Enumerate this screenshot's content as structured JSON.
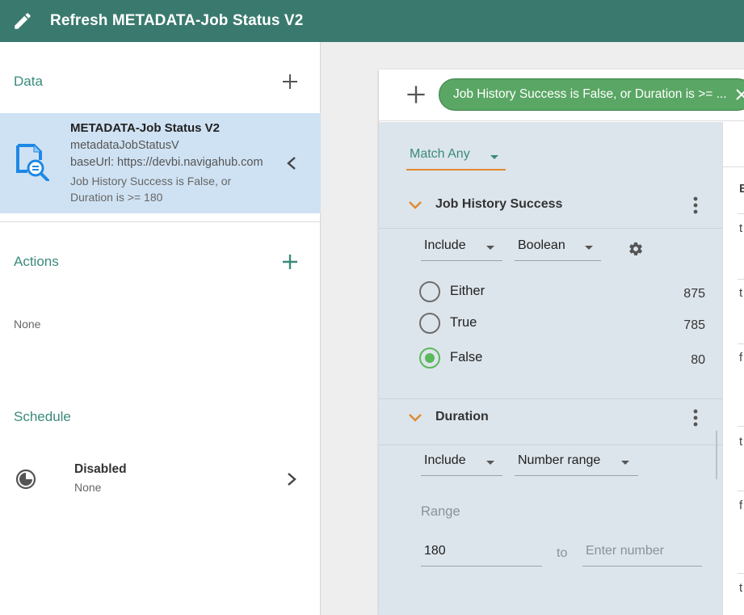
{
  "header": {
    "title": "Refresh METADATA-Job Status V2",
    "icon": "pencil-icon"
  },
  "left": {
    "data": {
      "title": "Data",
      "item": {
        "name": "METADATA-Job Status V2",
        "id": "metadataJobStatusV",
        "base_url": "baseUrl: https://devbi.navigahub.com",
        "description": "Job History Success is False, or Duration is >= 180"
      }
    },
    "actions": {
      "title": "Actions",
      "value": "None"
    },
    "schedule": {
      "title": "Schedule",
      "status": "Disabled",
      "value": "None"
    }
  },
  "filter": {
    "chip_label": "Job History Success is False, or Duration is >= ...",
    "match_mode": "Match Any",
    "groups": [
      {
        "title": "Job History Success",
        "mode": "Include",
        "type": "Boolean",
        "options": [
          {
            "label": "Either",
            "count": "875",
            "selected": false
          },
          {
            "label": "True",
            "count": "785",
            "selected": false
          },
          {
            "label": "False",
            "count": "80",
            "selected": true
          }
        ]
      },
      {
        "title": "Duration",
        "mode": "Include",
        "type": "Number range",
        "range_label": "Range",
        "from_value": "180",
        "to_label": "to",
        "to_placeholder": "Enter number"
      }
    ]
  },
  "results": {
    "header_partial": "E",
    "cells_partial": [
      "t",
      "t",
      "f",
      "t",
      "f",
      "t"
    ]
  },
  "colors": {
    "header_bg": "#3a7a6e",
    "accent_teal": "#3a8a7c",
    "selected_item_bg": "#cfe2f3",
    "chip_green": "#5aa664",
    "radio_green": "#5cb85c",
    "match_underline": "#e0892f",
    "panel_bg": "#dde5ec"
  }
}
